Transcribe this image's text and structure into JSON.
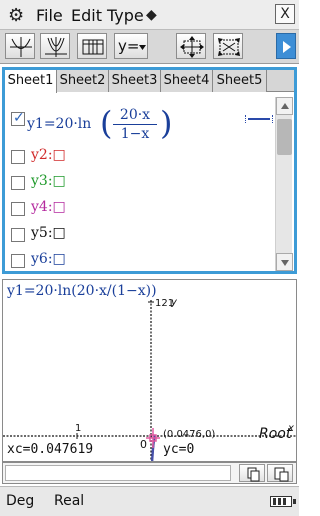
{
  "menu": {
    "items": [
      "File",
      "Edit",
      "Type"
    ],
    "close_label": "X"
  },
  "toolbar": {
    "y_equals_label": "y="
  },
  "editor": {
    "tabs": [
      "Sheet1",
      "Sheet2",
      "Sheet3",
      "Sheet4",
      "Sheet5"
    ],
    "active_tab": 0,
    "function_1": {
      "prefix": "y1=20·ln",
      "numerator": "20·x",
      "denominator": "1−x",
      "checked": true
    },
    "slots": [
      {
        "label": "y2:□",
        "color": "#d12a2a"
      },
      {
        "label": "y3:□",
        "color": "#1f9a2b"
      },
      {
        "label": "y4:□",
        "color": "#b4299e"
      },
      {
        "label": "y5:□",
        "color": "#111111"
      },
      {
        "label": "y6:□",
        "color": "#1a3f9a"
      }
    ]
  },
  "graph": {
    "title": "y1=20·ln(20·x/(1−x))",
    "y_tick_label": "121",
    "y_axis_label": "y",
    "x_tick_label": "1",
    "origin_label": "0",
    "root_coord_label": "(0.0476,0)",
    "x_axis_label": "x",
    "mode_label": "Root",
    "xc_readout": "xc=0.047619",
    "yc_readout": "yc=0",
    "curve_color": "#4650a8"
  },
  "status": {
    "angle_mode": "Deg",
    "number_mode": "Real"
  }
}
